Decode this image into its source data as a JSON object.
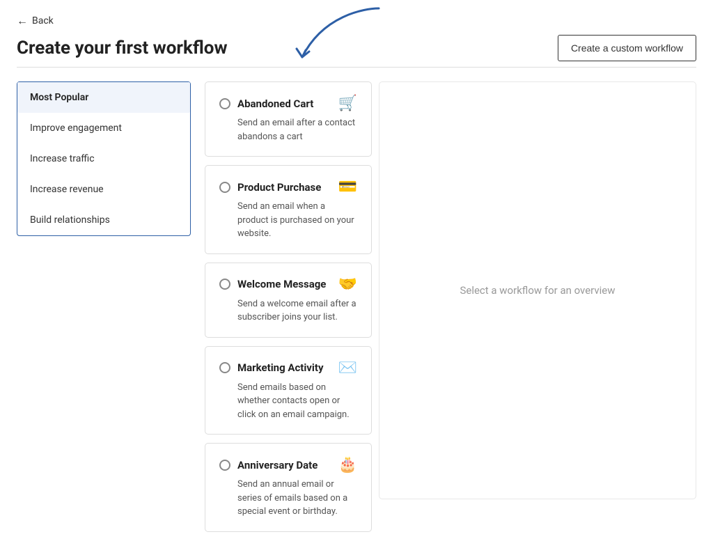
{
  "back_label": "Back",
  "page_title": "Create your first workflow",
  "create_custom_btn": "Create a custom workflow",
  "sidebar": {
    "items": [
      {
        "id": "most-popular",
        "label": "Most Popular",
        "active": true
      },
      {
        "id": "improve-engagement",
        "label": "Improve engagement",
        "active": false
      },
      {
        "id": "increase-traffic",
        "label": "Increase traffic",
        "active": false
      },
      {
        "id": "increase-revenue",
        "label": "Increase revenue",
        "active": false
      },
      {
        "id": "build-relationships",
        "label": "Build relationships",
        "active": false
      }
    ]
  },
  "workflows": [
    {
      "id": "abandoned-cart",
      "title": "Abandoned Cart",
      "description": "Send an email after a contact abandons a cart",
      "icon": "🛒"
    },
    {
      "id": "product-purchase",
      "title": "Product Purchase",
      "description": "Send an email when a product is purchased on your website.",
      "icon": "💳"
    },
    {
      "id": "welcome-message",
      "title": "Welcome Message",
      "description": "Send a welcome email after a subscriber joins your list.",
      "icon": "🤝"
    },
    {
      "id": "marketing-activity",
      "title": "Marketing Activity",
      "description": "Send emails based on whether contacts open or click on an email campaign.",
      "icon": "✉️"
    },
    {
      "id": "anniversary-date",
      "title": "Anniversary Date",
      "description": "Send an annual email or series of emails based on a special event or birthday.",
      "icon": "🎂"
    }
  ],
  "overview_placeholder": "Select a workflow for an overview"
}
